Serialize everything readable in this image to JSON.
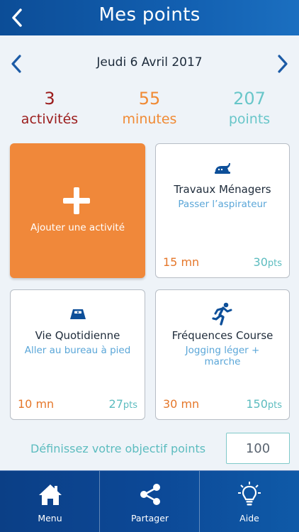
{
  "header": {
    "title": "Mes points"
  },
  "date_nav": {
    "date": "Jeudi 6 Avril 2017"
  },
  "stats": {
    "activities": {
      "value": "3",
      "label": "activités"
    },
    "minutes": {
      "value": "55",
      "label": "minutes"
    },
    "points": {
      "value": "207",
      "label": "points"
    }
  },
  "add_card": {
    "label": "Ajouter une activité"
  },
  "cards": [
    {
      "icon": "iron-icon",
      "title": "Travaux Ménagers",
      "subtitle": "Passer l’aspirateur",
      "minutes": "15 mn",
      "points": "30",
      "unit": "pts"
    },
    {
      "icon": "scale-icon",
      "title": "Vie Quotidienne",
      "subtitle": "Aller au bureau à pied",
      "minutes": "10 mn",
      "points": "27",
      "unit": "pts"
    },
    {
      "icon": "runner-icon",
      "title": "Fréquences Course",
      "subtitle": "Jogging léger + marche",
      "minutes": "30 mn",
      "points": "150",
      "unit": "pts"
    }
  ],
  "goal": {
    "label": "Définissez votre objectif points",
    "value": "100"
  },
  "footer": {
    "menu": "Menu",
    "share": "Partager",
    "help": "Aide"
  },
  "colors": {
    "header_blue": "#0c4d97",
    "activities_red": "#9b1c1c",
    "minutes_orange": "#f08a34",
    "points_teal": "#68c6c9",
    "add_card_orange": "#f0883a",
    "subtitle_blue": "#5aa6d8"
  }
}
